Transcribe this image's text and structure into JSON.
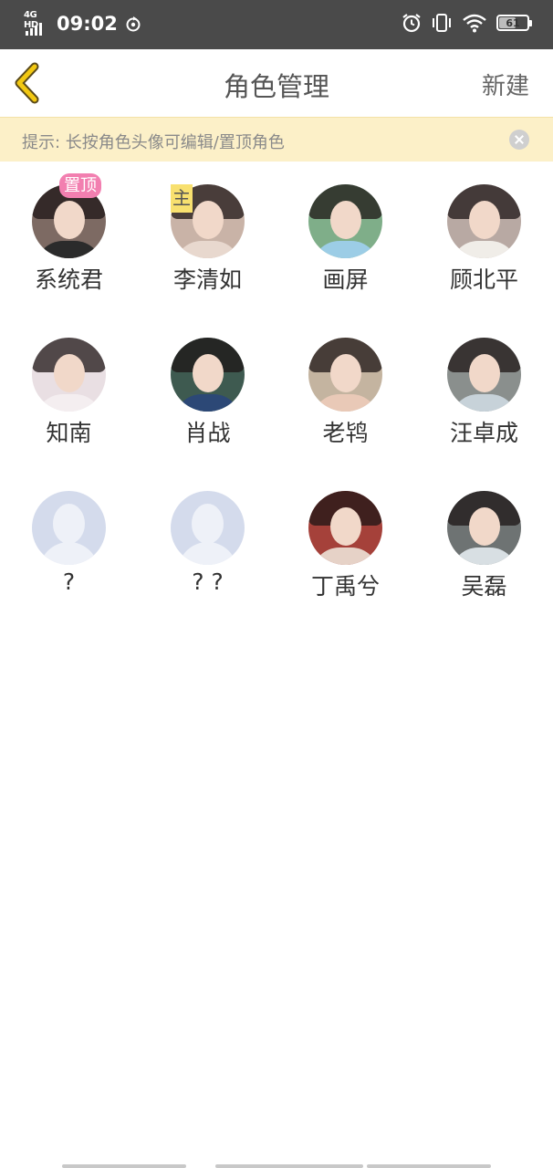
{
  "status_bar": {
    "network": "4G HD",
    "time": "09:02",
    "battery": "61",
    "battery_level": 0.61,
    "icons": [
      "signal-icon",
      "sync-icon",
      "alarm-icon",
      "vibrate-icon",
      "wifi-icon",
      "battery-icon"
    ]
  },
  "header": {
    "back_icon": "chevron-left-icon",
    "title": "角色管理",
    "new_label": "新建"
  },
  "tip": {
    "text": "提示: 长按角色头像可编辑/置顶角色",
    "close_icon": "close-icon"
  },
  "badges": {
    "pinned": "置顶",
    "main": "主"
  },
  "colors": {
    "status_bar": "#4a4a4a",
    "tip_background": "#fcf0c8",
    "pinned_badge": "#f27fb0",
    "main_badge": "#f8e06f",
    "back_arrow": "#e6b800",
    "placeholder_avatar": "#d4dbec"
  },
  "roles": [
    {
      "name": "系统君",
      "pinned": true,
      "avatar": "photo",
      "bg": "#7d6a63",
      "clothes": "#2b2b2b"
    },
    {
      "name": "李清如",
      "main": true,
      "avatar": "photo",
      "bg": "#c9b3a7",
      "clothes": "#e8d8ce"
    },
    {
      "name": "画屏",
      "avatar": "photo",
      "bg": "#7fae89",
      "clothes": "#9ccde6"
    },
    {
      "name": "顾北平",
      "avatar": "photo",
      "bg": "#b8a9a3",
      "clothes": "#f0ede8"
    },
    {
      "name": "知南",
      "avatar": "photo",
      "bg": "#e9dfe3",
      "clothes": "#f4eef0"
    },
    {
      "name": "肖战",
      "avatar": "photo",
      "bg": "#3e5a50",
      "clothes": "#2c4876"
    },
    {
      "name": "老鸨",
      "avatar": "photo",
      "bg": "#c4b4a0",
      "clothes": "#e9c9b7"
    },
    {
      "name": "汪卓成",
      "avatar": "photo",
      "bg": "#8a8f8d",
      "clothes": "#c7d2d9"
    },
    {
      "name": "?",
      "avatar": "placeholder"
    },
    {
      "name": "? ?",
      "avatar": "placeholder"
    },
    {
      "name": "丁禹兮",
      "avatar": "photo",
      "bg": "#a5413a",
      "clothes": "#e6d2c7"
    },
    {
      "name": "吴磊",
      "avatar": "photo",
      "bg": "#6e7373",
      "clothes": "#d8dfe3"
    }
  ]
}
